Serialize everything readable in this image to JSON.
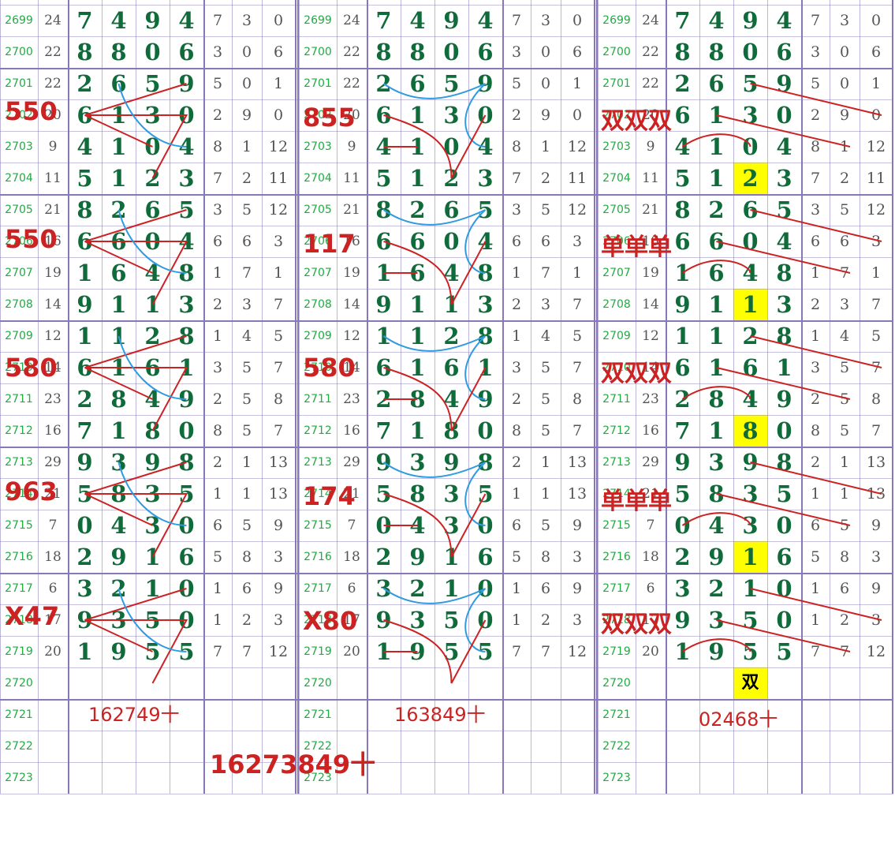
{
  "ids": [
    "2699",
    "2700",
    "2701",
    "2702",
    "2703",
    "2704",
    "2705",
    "2706",
    "2707",
    "2708",
    "2709",
    "2710",
    "2711",
    "2712",
    "2713",
    "2714",
    "2715",
    "2716",
    "2717",
    "2718",
    "2719",
    "2720",
    "2721",
    "2722",
    "2723"
  ],
  "sums": [
    "24",
    "22",
    "22",
    "20",
    "9",
    "11",
    "21",
    "16",
    "19",
    "14",
    "12",
    "14",
    "23",
    "16",
    "29",
    "21",
    "7",
    "18",
    "6",
    "17",
    "20",
    "",
    "",
    "",
    ""
  ],
  "digits": [
    [
      "7",
      "4",
      "9",
      "4"
    ],
    [
      "8",
      "8",
      "0",
      "6"
    ],
    [
      "2",
      "6",
      "5",
      "9"
    ],
    [
      "6",
      "1",
      "3",
      "0"
    ],
    [
      "4",
      "1",
      "0",
      "4"
    ],
    [
      "5",
      "1",
      "2",
      "3"
    ],
    [
      "8",
      "2",
      "6",
      "5"
    ],
    [
      "6",
      "6",
      "0",
      "4"
    ],
    [
      "1",
      "6",
      "4",
      "8"
    ],
    [
      "9",
      "1",
      "1",
      "3"
    ],
    [
      "1",
      "1",
      "2",
      "8"
    ],
    [
      "6",
      "1",
      "6",
      "1"
    ],
    [
      "2",
      "8",
      "4",
      "9"
    ],
    [
      "7",
      "1",
      "8",
      "0"
    ],
    [
      "9",
      "3",
      "9",
      "8"
    ],
    [
      "5",
      "8",
      "3",
      "5"
    ],
    [
      "0",
      "4",
      "3",
      "0"
    ],
    [
      "2",
      "9",
      "1",
      "6"
    ],
    [
      "3",
      "2",
      "1",
      "0"
    ],
    [
      "9",
      "3",
      "5",
      "0"
    ],
    [
      "1",
      "9",
      "5",
      "5"
    ],
    [
      "",
      "",
      "",
      ""
    ],
    [
      "",
      "",
      "",
      ""
    ],
    [
      "",
      "",
      "",
      ""
    ],
    [
      "",
      "",
      "",
      ""
    ]
  ],
  "smalls": [
    [
      "7",
      "3",
      "0"
    ],
    [
      "3",
      "0",
      "6"
    ],
    [
      "5",
      "0",
      "1"
    ],
    [
      "2",
      "9",
      "0"
    ],
    [
      "8",
      "1",
      "12"
    ],
    [
      "7",
      "2",
      "11"
    ],
    [
      "3",
      "5",
      "12"
    ],
    [
      "6",
      "6",
      "3"
    ],
    [
      "1",
      "7",
      "1"
    ],
    [
      "2",
      "3",
      "7"
    ],
    [
      "1",
      "4",
      "5"
    ],
    [
      "3",
      "5",
      "7"
    ],
    [
      "2",
      "5",
      "8"
    ],
    [
      "8",
      "5",
      "7"
    ],
    [
      "2",
      "1",
      "13"
    ],
    [
      "1",
      "1",
      "13"
    ],
    [
      "6",
      "5",
      "9"
    ],
    [
      "5",
      "8",
      "3"
    ],
    [
      "1",
      "6",
      "9"
    ],
    [
      "1",
      "2",
      "3"
    ],
    [
      "7",
      "7",
      "12"
    ],
    [
      "",
      "",
      ""
    ],
    [
      "",
      "",
      ""
    ],
    [
      "",
      "",
      ""
    ],
    [
      "",
      "",
      ""
    ]
  ],
  "highlights": [
    {
      "row": 5,
      "value": "2"
    },
    {
      "row": 9,
      "value": "1"
    },
    {
      "row": 13,
      "value": "8"
    },
    {
      "row": 17,
      "value": "1"
    },
    {
      "row": 21,
      "value": "双"
    }
  ],
  "annotations": {
    "p1_n1": "550",
    "p1_n2": "550",
    "p1_n3": "580",
    "p1_n4": "963",
    "p1_n5": "X47",
    "p2_n1": "855",
    "p2_n2": "117",
    "p2_n3": "580",
    "p2_n4": "174",
    "p2_n5": "X80",
    "p3_n1": "双双双",
    "p3_n2": "单单单",
    "p3_n3": "双双双",
    "p3_n4": "单单单",
    "p3_n5": "双双双",
    "p1_formula": "162749十",
    "p2_formula": "163849十",
    "p3_formula": "02468十",
    "combined": "16273849十"
  },
  "colors": {
    "grid": "#8878b8",
    "digit": "#106b3a",
    "id": "#22aa44",
    "red": "#cc2222",
    "blue": "#2f9be0",
    "highlight": "#ffff00"
  }
}
